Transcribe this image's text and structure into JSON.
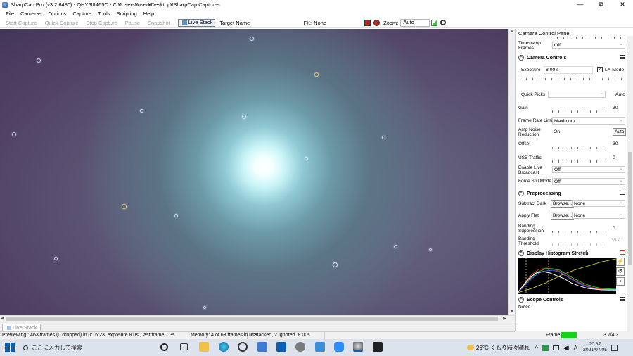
{
  "window": {
    "title": "SharpCap Pro (v3.2.6480) - QHY5III465C - C:¥Users¥user¥Desktop¥SharpCap Captures",
    "minimize": "—",
    "maximize": "⧉",
    "close": "✕"
  },
  "menu": [
    "File",
    "Cameras",
    "Options",
    "Capture",
    "Tools",
    "Scripting",
    "Help"
  ],
  "toolbar": {
    "start_capture": "Start Capture",
    "quick_capture": "Quick Capture",
    "stop_capture": "Stop Capture",
    "pause": "Pause",
    "snapshot": "Snapshot",
    "live_stack": "Live Stack",
    "target_name_label": "Target Name :",
    "fx_label": "FX:",
    "fx_value": "None",
    "zoom_label": "Zoom:",
    "zoom_value": "Auto"
  },
  "live_stack_tab": "Live Stack",
  "status": {
    "previewing": "Previewing : 463 frames (0 dropped) in 0:16:23, exposure 8.0s , last frame 7.3s",
    "memory": "Memory: 4 of 63 frames in use.",
    "stacked": "1 Stacked, 2 Ignored. 8.00s",
    "frame_label": "Frame:",
    "fps": "3.7/4.3"
  },
  "panel": {
    "title": "Camera Control Panel",
    "timestamp_label": "Timestamp Frames",
    "timestamp_value": "Off",
    "camera_controls": {
      "title": "Camera Controls",
      "exposure_label": "Exposure",
      "exposure_value": "8.00 s",
      "lx_mode_label": "LX Mode",
      "lx_check": "✓",
      "quick_picks_label": "Quick Picks",
      "quick_picks_auto": "Auto",
      "gain_label": "Gain",
      "gain_value": "30",
      "frame_rate_label": "Frame Rate Limit",
      "frame_rate_value": "Maximum",
      "amp_noise_label": "Amp Noise Reduction",
      "amp_noise_value": "On",
      "amp_noise_auto": "Auto",
      "offset_label": "Offset",
      "offset_value": "30",
      "usb_label": "USB Traffic",
      "usb_value": "0",
      "live_broadcast_label": "Enable Live Broadcast",
      "live_broadcast_value": "Off",
      "force_still_label": "Force Still Mode",
      "force_still_value": "Off"
    },
    "preprocessing": {
      "title": "Preprocessing",
      "subtract_dark_label": "Subtract Dark",
      "apply_flat_label": "Apply Flat",
      "browse": "Browse...",
      "none": "None",
      "banding_supp_label": "Banding Suppression",
      "banding_supp_value": "0",
      "banding_thr_label": "Banding Threshold",
      "banding_thr_value": "35.0"
    },
    "histogram": {
      "title": "Display Histogram Stretch"
    },
    "scope": {
      "title": "Scope Controls",
      "notes_label": "Notes"
    }
  },
  "taskbar": {
    "search_placeholder": "ここに入力して検索",
    "weather": "26°C くもり時々晴れ",
    "time": "20:37",
    "date": "2021/07/05",
    "ime": "A"
  },
  "colors": {
    "accent": "#0a5fb4",
    "frame_indicator": "#19d119",
    "histogram_bg": "#000000",
    "section_icon_red": "#c0392b"
  }
}
